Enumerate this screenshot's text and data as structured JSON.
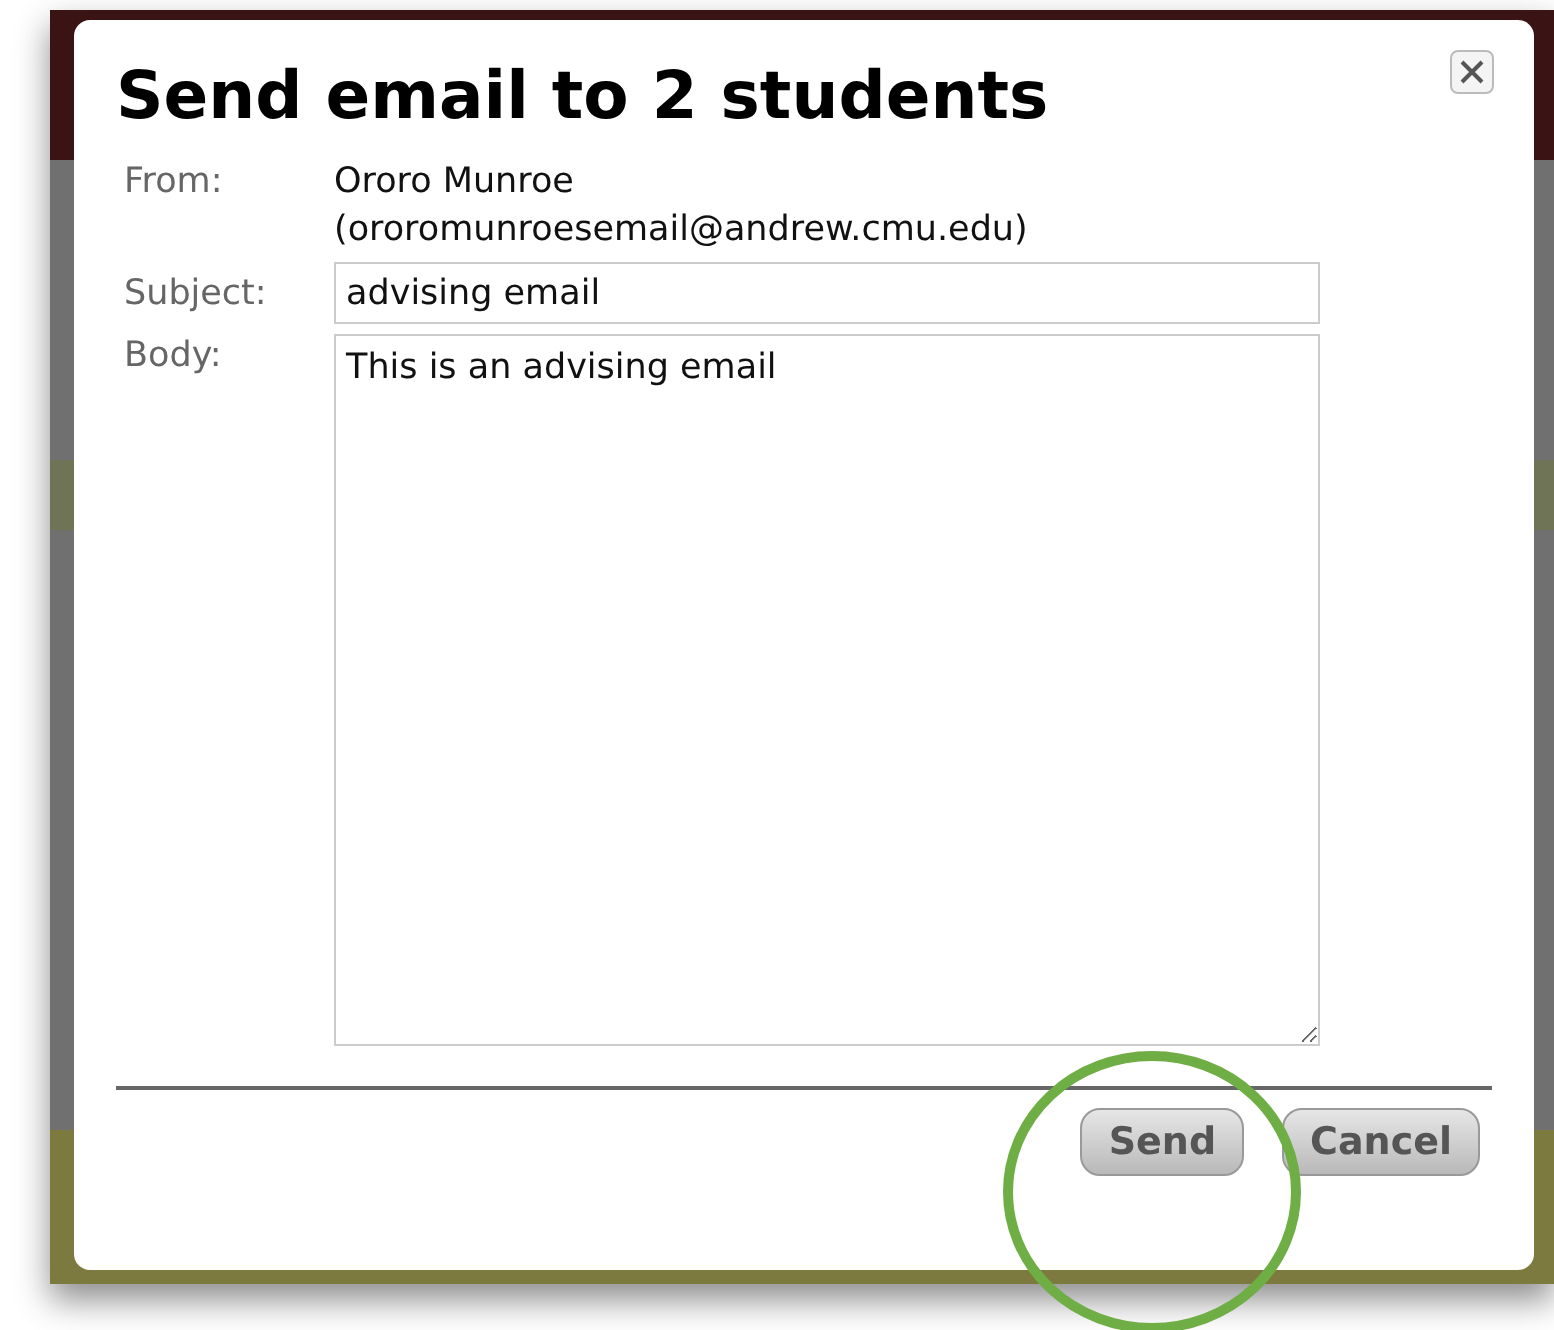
{
  "dialog": {
    "title": "Send email to 2 students",
    "from": {
      "label": "From:",
      "name": "Ororo Munroe",
      "address": "(ororomunroesemail@andrew.cmu.edu)"
    },
    "subject": {
      "label": "Subject:",
      "value": "advising email"
    },
    "body": {
      "label": "Body:",
      "value": "This is an advising email"
    },
    "buttons": [
      "Send",
      "Cancel"
    ]
  }
}
